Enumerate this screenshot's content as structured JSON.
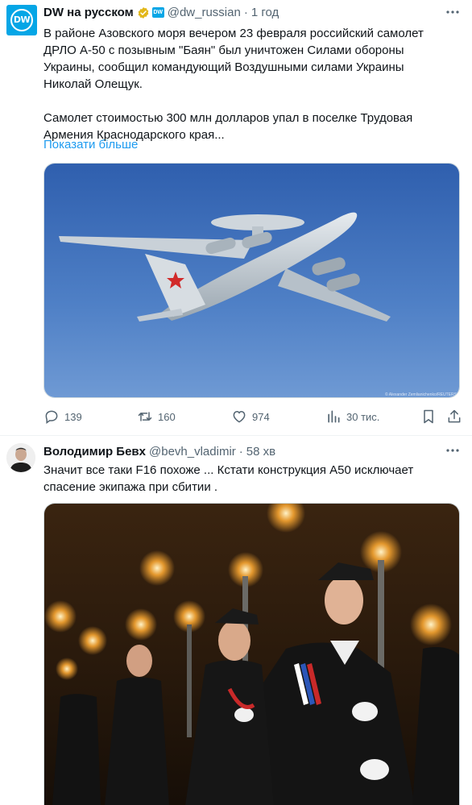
{
  "tweet1": {
    "author_name": "DW на русском",
    "handle": "@dw_russian",
    "separator": "·",
    "time": "1 год",
    "avatar_text": "DW",
    "affiliate_text": "DW",
    "paragraph1": "В районе Азовского моря вечером 23 февраля российский самолет\nДРЛО А-50 с позывным \"Баян\" был уничтожен Силами обороны\nУкраины, сообщил командующий Воздушными силами Украины\nНиколай Олещук.",
    "paragraph2": "Самолет стоимостью 300 млн долларов упал в поселке Трудовая\nАрмения Краснодарского края...",
    "show_more": "Показати більше",
    "photo_credit": "© Alexander Zemlianichenko/REUTERS",
    "replies": "139",
    "retweets": "160",
    "likes": "974",
    "views": "30 тис."
  },
  "tweet2": {
    "author_name": "Володимир Бевх",
    "handle": "@bevh_vladimir",
    "separator": "·",
    "time": "58 хв",
    "text": "Значит все таки F16 похоже ... Кстати конструкция А50 исключает\nспасение экипажа при сбитии ."
  },
  "colors": {
    "accent": "#1d9bf0",
    "dw_blue": "#05a6e6",
    "secondary_text": "#536471",
    "verified_gold": "#e2b719"
  },
  "icons": [
    "verified-badge-icon",
    "dw-affiliate-icon",
    "more-icon",
    "reply-icon",
    "retweet-icon",
    "like-icon",
    "views-icon",
    "bookmark-icon",
    "share-icon"
  ]
}
